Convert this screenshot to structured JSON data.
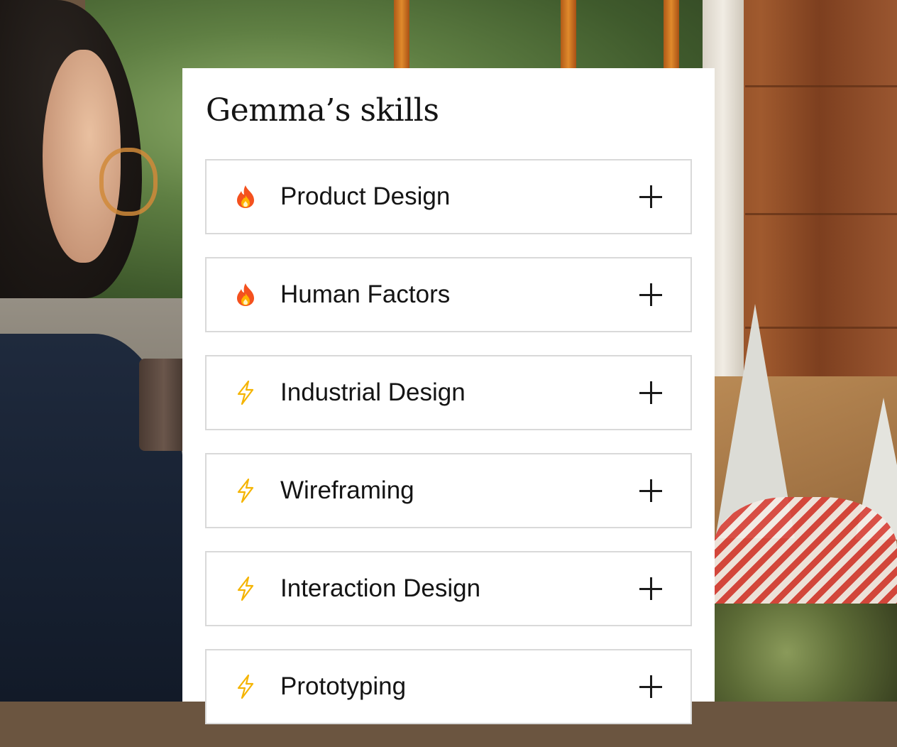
{
  "panel": {
    "title": "Gemma’s skills"
  },
  "skills": [
    {
      "label": "Product Design",
      "icon": "fire-icon"
    },
    {
      "label": "Human Factors",
      "icon": "fire-icon"
    },
    {
      "label": "Industrial Design",
      "icon": "lightning-icon"
    },
    {
      "label": "Wireframing",
      "icon": "lightning-icon"
    },
    {
      "label": "Interaction Design",
      "icon": "lightning-icon"
    },
    {
      "label": "Prototyping",
      "icon": "lightning-icon"
    }
  ],
  "colors": {
    "panel_bg": "#ffffff",
    "row_border": "#d9d9d9",
    "text": "#141414",
    "fire": "#f4511e",
    "lightning": "#f5b400"
  }
}
